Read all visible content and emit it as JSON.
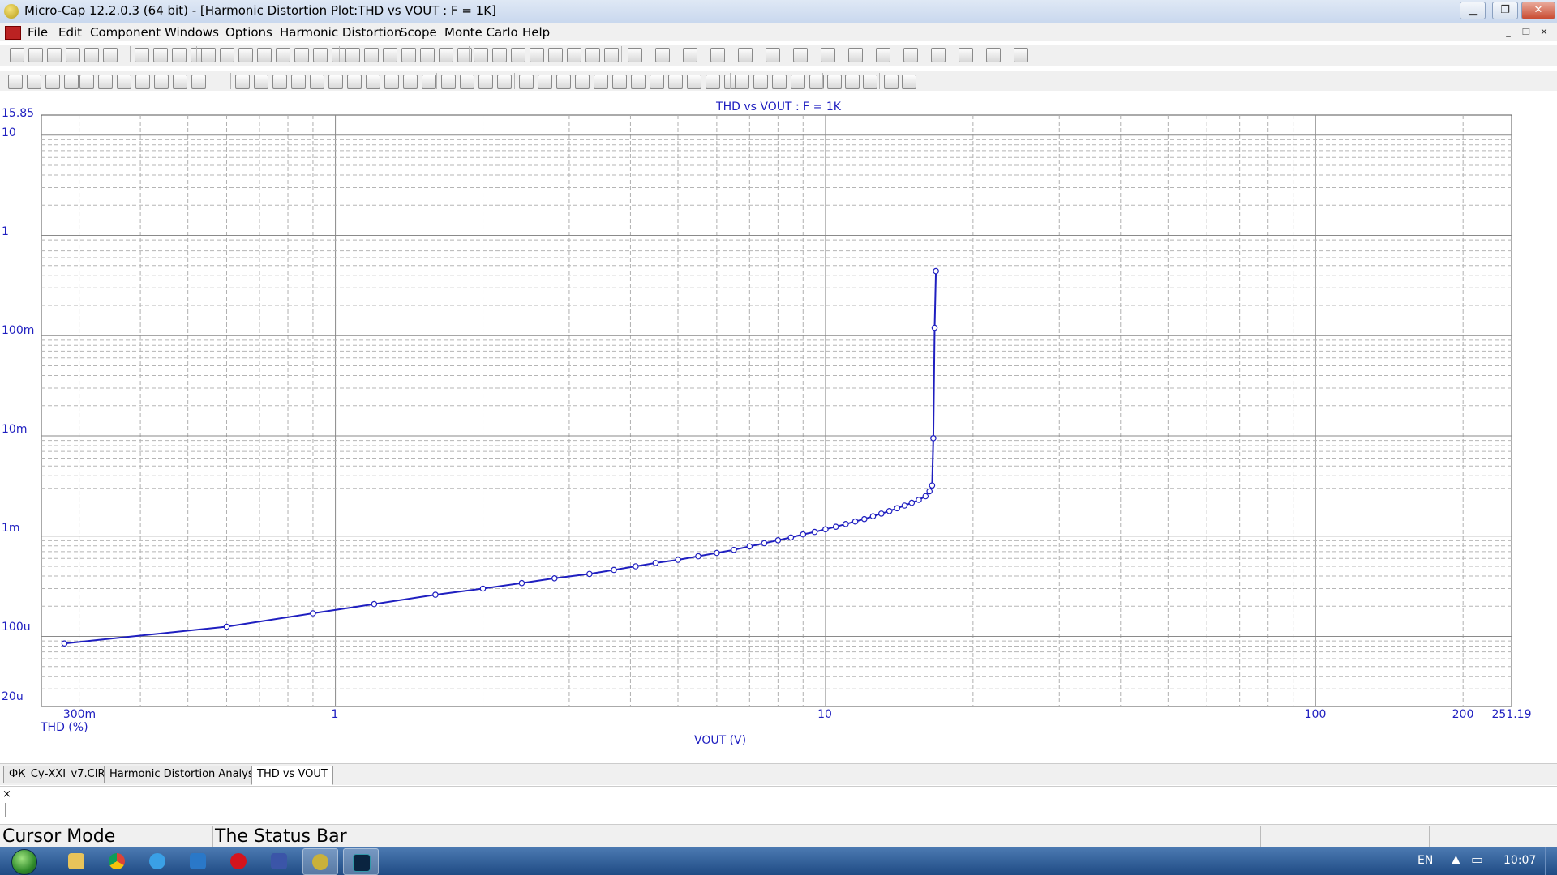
{
  "window": {
    "title": "Micro-Cap 12.2.0.3 (64 bit) - [Harmonic Distortion Plot:THD vs VOUT : F = 1K]"
  },
  "menu": [
    "File",
    "Edit",
    "Component",
    "Windows",
    "Options",
    "Harmonic Distortion",
    "Scope",
    "Monte Carlo",
    "Help"
  ],
  "plot": {
    "title": "THD vs VOUT : F = 1K",
    "y_axis_label": "THD (%)",
    "x_axis_label": "VOUT (V)",
    "y_tick_labels": [
      "15.85",
      "10",
      "1",
      "100m",
      "10m",
      "1m",
      "100u",
      "20u"
    ],
    "x_tick_labels": [
      "300m",
      "1",
      "10",
      "100",
      "200",
      "251.19"
    ]
  },
  "chart_data": {
    "type": "line",
    "title": "THD vs VOUT : F = 1K",
    "xlabel": "VOUT (V)",
    "ylabel": "THD (%)",
    "x_scale": "log",
    "y_scale": "log",
    "xlim": [
      0.2512,
      251.19
    ],
    "ylim": [
      2e-05,
      15.85
    ],
    "grid": true,
    "color": "#1f1fc0",
    "series": [
      {
        "x": [
          0.28,
          0.6,
          0.9,
          1.2,
          1.6,
          2.0,
          2.4,
          2.8,
          3.3,
          3.7,
          4.1,
          4.5,
          5.0,
          5.5,
          6.0,
          6.5,
          7.0,
          7.5,
          8.0,
          8.5,
          9.0,
          9.5,
          10.0,
          10.5,
          11.0,
          11.5,
          12.0,
          12.5,
          13.0,
          13.5,
          14.0,
          14.5,
          15.0,
          15.5,
          16.0,
          16.3,
          16.5,
          16.6,
          16.7,
          16.8
        ],
        "y": [
          8.5e-05,
          0.000125,
          0.00017,
          0.00021,
          0.00026,
          0.0003,
          0.00034,
          0.00038,
          0.00042,
          0.00046,
          0.0005,
          0.00054,
          0.00058,
          0.00063,
          0.00068,
          0.00073,
          0.00079,
          0.00085,
          0.00091,
          0.00097,
          0.00104,
          0.0011,
          0.00117,
          0.00124,
          0.00132,
          0.0014,
          0.00148,
          0.00158,
          0.00168,
          0.00178,
          0.0019,
          0.00202,
          0.00215,
          0.0023,
          0.0025,
          0.0028,
          0.0032,
          0.0095,
          0.12,
          0.44
        ]
      }
    ]
  },
  "tabs": [
    "ФК_Су-XXI_v7.CIR",
    "Harmonic Distortion Analysis",
    "THD vs VOUT"
  ],
  "status": {
    "left": "Cursor Mode",
    "main": "The Status Bar"
  },
  "tray": {
    "lang": "EN",
    "time": "10:07"
  },
  "message_pane": {
    "close_glyph": "×"
  }
}
